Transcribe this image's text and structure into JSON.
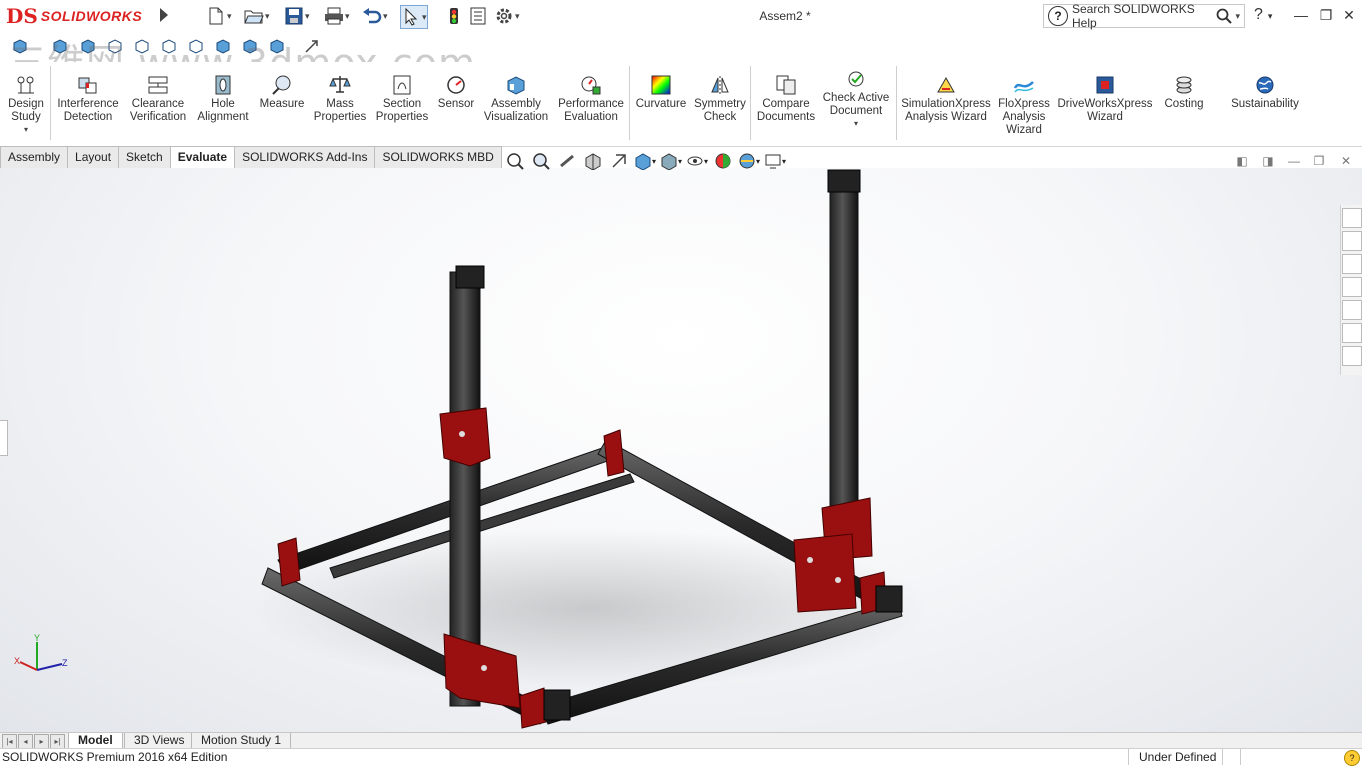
{
  "app": {
    "title": "Assem2 *",
    "logo_text": "SOLIDWORKS",
    "watermark": "三维网 www.3dmox.com"
  },
  "search": {
    "placeholder": "Search SOLIDWORKS Help"
  },
  "help_label": "?",
  "ribbon": {
    "commands": [
      {
        "id": "design-study",
        "label": [
          "Design",
          "Study"
        ],
        "has_dropdown": true,
        "icon": "design-study-icon"
      },
      {
        "id": "interference-detection",
        "label": [
          "Interference",
          "Detection"
        ],
        "icon": "interference-icon"
      },
      {
        "id": "clearance-verification",
        "label": [
          "Clearance",
          "Verification"
        ],
        "icon": "clearance-icon"
      },
      {
        "id": "hole-alignment",
        "label": [
          "Hole",
          "Alignment"
        ],
        "icon": "hole-alignment-icon"
      },
      {
        "id": "measure",
        "label": [
          "Measure"
        ],
        "icon": "measure-icon"
      },
      {
        "id": "mass-properties",
        "label": [
          "Mass",
          "Properties"
        ],
        "icon": "mass-properties-icon"
      },
      {
        "id": "section-properties",
        "label": [
          "Section",
          "Properties"
        ],
        "icon": "section-properties-icon"
      },
      {
        "id": "sensor",
        "label": [
          "Sensor"
        ],
        "icon": "sensor-icon"
      },
      {
        "id": "assembly-visualization",
        "label": [
          "Assembly",
          "Visualization"
        ],
        "icon": "assembly-visualization-icon"
      },
      {
        "id": "performance-evaluation",
        "label": [
          "Performance",
          "Evaluation"
        ],
        "icon": "performance-icon"
      },
      {
        "id": "curvature",
        "label": [
          "Curvature"
        ],
        "icon": "curvature-icon"
      },
      {
        "id": "symmetry-check",
        "label": [
          "Symmetry",
          "Check"
        ],
        "icon": "symmetry-icon"
      },
      {
        "id": "compare-documents",
        "label": [
          "Compare",
          "Documents"
        ],
        "icon": "compare-icon"
      },
      {
        "id": "check-active-document",
        "label": [
          "Check Active",
          "Document"
        ],
        "has_dropdown": true,
        "icon": "check-document-icon"
      },
      {
        "id": "simulationxpress",
        "label": [
          "SimulationXpress",
          "Analysis Wizard"
        ],
        "icon": "simulation-icon"
      },
      {
        "id": "floxpress",
        "label": [
          "FloXpress",
          "Analysis",
          "Wizard"
        ],
        "icon": "floxpress-icon"
      },
      {
        "id": "driveworksxpress",
        "label": [
          "DriveWorksXpress",
          "Wizard"
        ],
        "icon": "driveworks-icon"
      },
      {
        "id": "costing",
        "label": [
          "Costing"
        ],
        "icon": "costing-icon"
      },
      {
        "id": "sustainability",
        "label": [
          "Sustainability"
        ],
        "icon": "sustainability-icon"
      }
    ]
  },
  "tabs": [
    "Assembly",
    "Layout",
    "Sketch",
    "Evaluate",
    "SOLIDWORKS Add-Ins",
    "SOLIDWORKS MBD"
  ],
  "active_tab": "Evaluate",
  "bottom_tabs": [
    "Model",
    "3D Views",
    "Motion Study 1"
  ],
  "active_bottom_tab": "Model",
  "status": {
    "left": "SOLIDWORKS Premium 2016 x64 Edition",
    "right": "Under Defined"
  },
  "triad": {
    "x": "X",
    "y": "Y",
    "z": "Z"
  },
  "colors": {
    "accent": "#d22020",
    "frame": "#3a3a3a",
    "bracket": "#9a1010"
  }
}
